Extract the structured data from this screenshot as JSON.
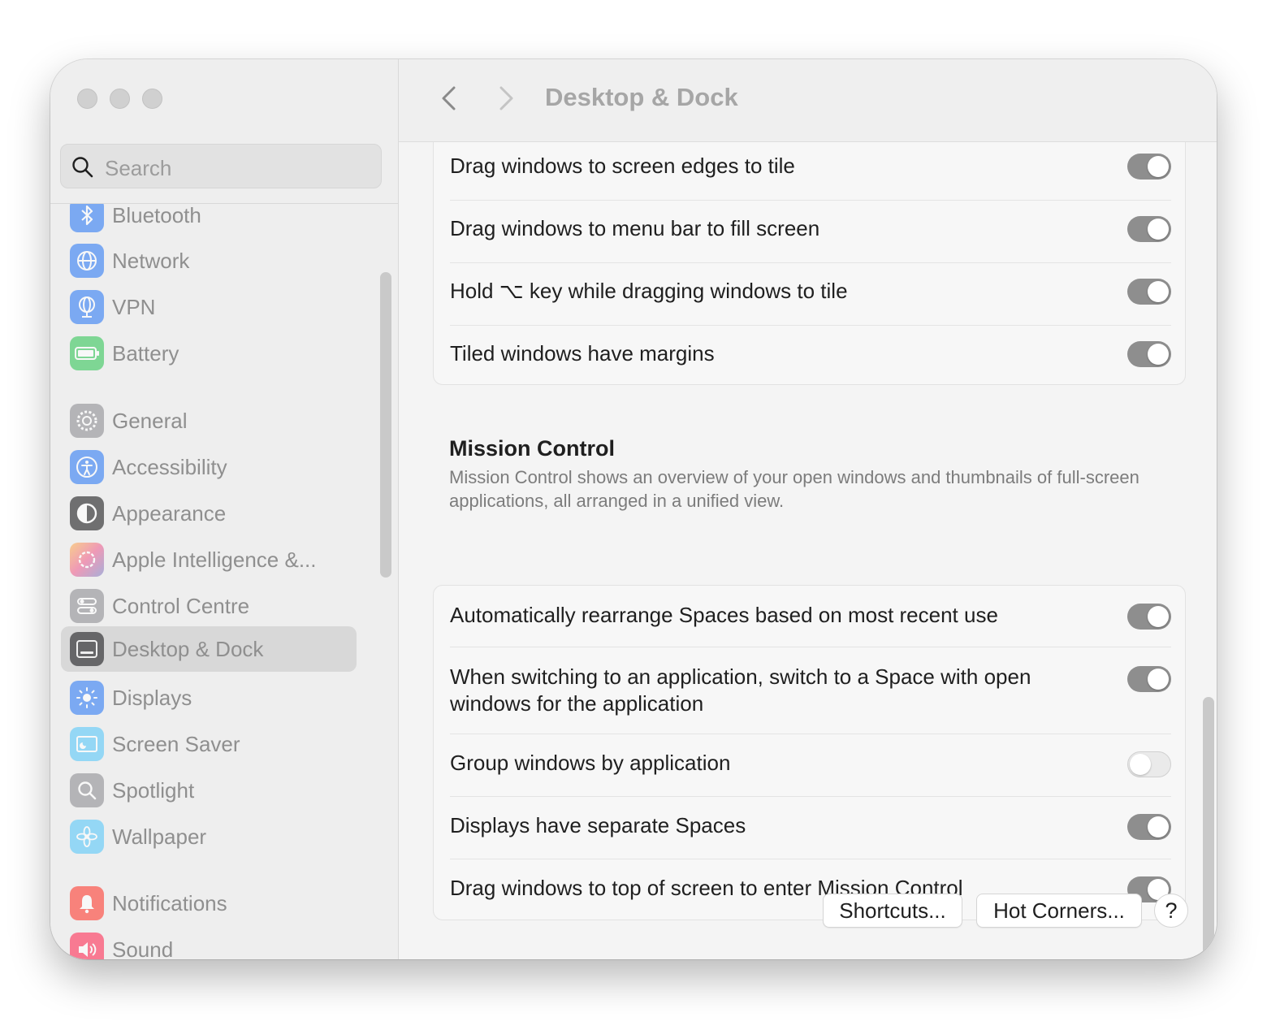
{
  "search": {
    "placeholder": "Search"
  },
  "sidebar": {
    "items": [
      {
        "label": "Bluetooth",
        "icon": "bluetooth-icon",
        "color": "#2f7cf6"
      },
      {
        "label": "Network",
        "icon": "globe-icon",
        "color": "#2f7cf6"
      },
      {
        "label": "VPN",
        "icon": "vpn-globe-icon",
        "color": "#2f7cf6"
      },
      {
        "label": "Battery",
        "icon": "battery-icon",
        "color": "#34c759"
      },
      {
        "label": "General",
        "icon": "gear-icon",
        "color": "#8e8e93"
      },
      {
        "label": "Accessibility",
        "icon": "accessibility-icon",
        "color": "#2f7cf6"
      },
      {
        "label": "Appearance",
        "icon": "appearance-icon",
        "color": "#1c1c1e"
      },
      {
        "label": "Apple Intelligence &...",
        "icon": "apple-intelligence-icon",
        "color": "#f06292"
      },
      {
        "label": "Control Centre",
        "icon": "control-centre-icon",
        "color": "#8e8e93"
      },
      {
        "label": "Desktop & Dock",
        "icon": "desktop-dock-icon",
        "color": "#1c1c1e",
        "selected": true
      },
      {
        "label": "Displays",
        "icon": "sun-icon",
        "color": "#2f7cf6"
      },
      {
        "label": "Screen Saver",
        "icon": "screen-saver-icon",
        "color": "#5ac8fa"
      },
      {
        "label": "Spotlight",
        "icon": "magnifier-icon",
        "color": "#8e8e93"
      },
      {
        "label": "Wallpaper",
        "icon": "flower-icon",
        "color": "#5ac8fa"
      },
      {
        "label": "Notifications",
        "icon": "bell-icon",
        "color": "#ff3b30"
      },
      {
        "label": "Sound",
        "icon": "speaker-icon",
        "color": "#ff2d55"
      }
    ]
  },
  "header": {
    "title": "Desktop & Dock",
    "back_icon": "chevron-left-icon",
    "forward_icon": "chevron-right-icon"
  },
  "tiling": {
    "rows": [
      {
        "label": "Drag windows to screen edges to tile",
        "on": true
      },
      {
        "label": "Drag windows to menu bar to fill screen",
        "on": true
      },
      {
        "label": "Hold ⌥ key while dragging windows to tile",
        "on": true
      },
      {
        "label": "Tiled windows have margins",
        "on": true
      }
    ]
  },
  "mission_control": {
    "title": "Mission Control",
    "description": "Mission Control shows an overview of your open windows and thumbnails of full-screen applications, all arranged in a unified view.",
    "rows": [
      {
        "label": "Automatically rearrange Spaces based on most recent use",
        "on": true
      },
      {
        "label": "When switching to an application, switch to a Space with open windows for the application",
        "on": true
      },
      {
        "label": "Group windows by application",
        "on": false
      },
      {
        "label": "Displays have separate Spaces",
        "on": true
      },
      {
        "label": "Drag windows to top of screen to enter Mission Control",
        "on": true
      }
    ]
  },
  "footer": {
    "shortcuts_label": "Shortcuts...",
    "hot_corners_label": "Hot Corners...",
    "help_label": "?"
  }
}
